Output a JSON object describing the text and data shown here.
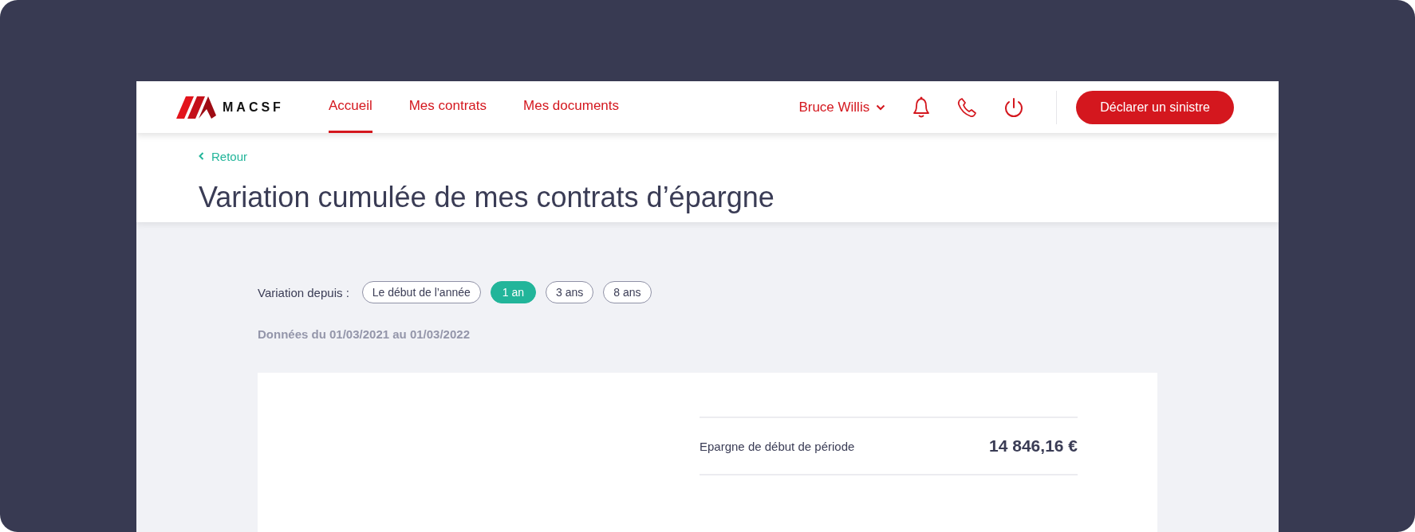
{
  "header": {
    "logo_text": "MACSF",
    "nav": [
      {
        "label": "Accueil",
        "selected": true
      },
      {
        "label": "Mes contrats",
        "selected": false
      },
      {
        "label": "Mes documents",
        "selected": false
      }
    ],
    "user": "Bruce Willis",
    "cta": "Déclarer un sinistre"
  },
  "back": "Retour",
  "title": "Variation cumulée de mes contrats d’épargne",
  "filter": {
    "label": "Variation depuis :",
    "options": [
      {
        "label": "Le début de l’année",
        "selected": false
      },
      {
        "label": "1 an",
        "selected": true
      },
      {
        "label": "3 ans",
        "selected": false
      },
      {
        "label": "8 ans",
        "selected": false
      }
    ]
  },
  "period": "Données du 01/03/2021 au 01/03/2022",
  "summary": [
    {
      "label": "Epargne de début de période",
      "value": "14 846,16 €"
    }
  ]
}
